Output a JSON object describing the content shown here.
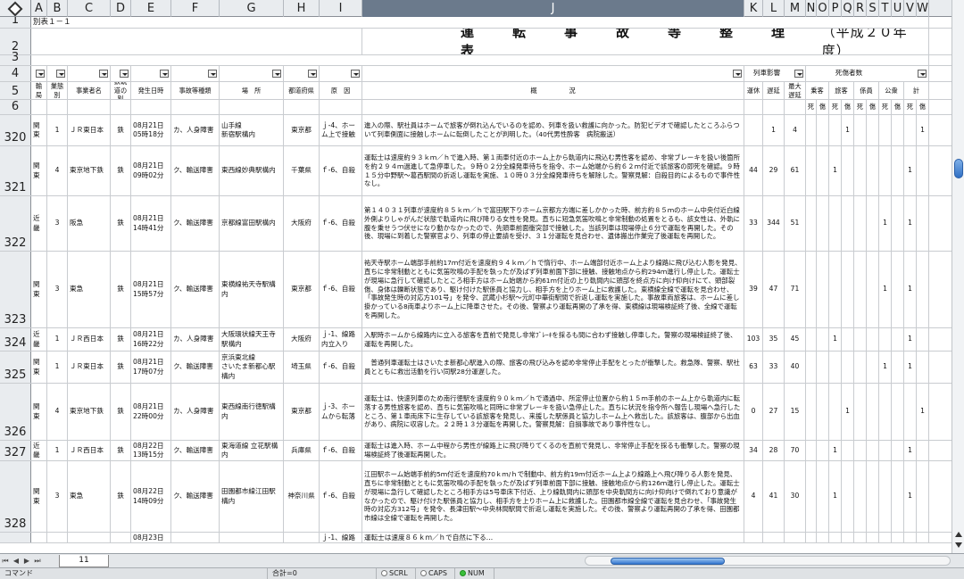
{
  "columns": [
    "A",
    "B",
    "C",
    "D",
    "E",
    "F",
    "G",
    "H",
    "I",
    "J",
    "K",
    "L",
    "M",
    "N",
    "O",
    "P",
    "Q",
    "R",
    "S",
    "T",
    "U",
    "V",
    "W"
  ],
  "selected_column": "J",
  "rownum_labels": {
    "r1": "1",
    "r2": "2",
    "r3": "3",
    "r4": "4",
    "r5": "5",
    "r6": "6"
  },
  "sheet": {
    "subtitle": "別表１－１",
    "title": "運　転　事　故　等　整　理　表",
    "title_year": "（平成２０年度）",
    "headers": {
      "bureau": "運輸局名",
      "type": "業態別",
      "operator": "事業者名",
      "track": "鉄軌道の別",
      "datetime": "発生日時",
      "accident_type": "事故等種類",
      "place": "場　所",
      "prefecture": "都道府県",
      "cause": "原　因",
      "summary": "概　　　　　況",
      "train_impact": "列車影響",
      "cancel": "運休",
      "delay": "遅延",
      "max_delay": "最大遅延",
      "casualties": "死傷者数",
      "crew": "乗客",
      "passenger": "旅客",
      "staff": "係員",
      "public": "公衆",
      "total": "計",
      "dead": "死",
      "injured": "傷"
    }
  },
  "records": [
    {
      "row": "320",
      "bureau": "関東",
      "type": "1",
      "operator": "ＪＲ東日本",
      "track": "鉄",
      "date": "08月21日",
      "time": "05時18分",
      "accident": "カ、人身障害",
      "place": "山手線\n新宿駅構内",
      "pref": "東京都",
      "cause": "ｊ-4、ホーム上で接触",
      "summary": "進入の際、駅社員はホームで旅客が倒れ込んでいるのを認め、列車を扱い救護に向かった。防犯ビデオで確認したところふらついて列車側面に接触しホームに転倒したことが判明した。（40代男性酔客　病院搬送）",
      "cancel": "",
      "delay": "1",
      "max": "4",
      "marks": {
        "passenger_inj": "1",
        "total_inj": "1"
      }
    },
    {
      "row": "321",
      "bureau": "関東",
      "type": "4",
      "operator": "東京地下鉄",
      "track": "鉄",
      "date": "08月21日",
      "time": "09時02分",
      "accident": "ク、輸送障害",
      "place": "東西線妙典駅構内",
      "pref": "千葉県",
      "cause": "ｆ-6、自殺",
      "summary": "運転士は速度約９３ｋｍ／ｈで進入時、第１両車付近のホーム上から軌道内に飛込む男性客を認め、非常ブレーキを扱い後箇所を約２９４ｍ過進して急停車した。９時０２分全線発車待ちを指令、ホーム始端から約６２ｍ付近で該旅客の即死を確認。９時１５分中野駅～葛西駅間の折返し運転を実施、１０時０３分全線発車待ちを解除した。警察見解：自殺目的によるもので事件性なし。",
      "cancel": "44",
      "delay": "29",
      "max": "61",
      "marks": {
        "passenger_dead": "1",
        "total_dead": "1"
      }
    },
    {
      "row": "322",
      "bureau": "近畿",
      "type": "3",
      "operator": "阪急",
      "track": "鉄",
      "date": "08月21日",
      "time": "14時41分",
      "accident": "ク、輸送障害",
      "place": "京都線富田駅構内",
      "pref": "大阪府",
      "cause": "ｆ-6、自殺",
      "summary": "第１４０３１列車が速度約８５ｋｍ／ｈで富田駅下りホーム京都方方端に差しかかった時、前方約８５ｍのホーム中央付近白線外側よりしゃがんだ状態で軌道内に飛び降りる女性を発見。直ちに短急気笛吹鳴と非常制動の処置をとるも、該女性は、外軌に腹を乗せうつ伏せになり動かなかったので、先頭車前面衝突部で接触した。当該列車は現場停止６分で運転を再開した。その後、現場に到着した警察官より、列車の停止要請を受け、３１分運転を見合わせ、遺体搬出作業完了後運転を再開した。",
      "cancel": "33",
      "delay": "344",
      "max": "51",
      "marks": {
        "public_dead": "1",
        "total_dead": "1"
      }
    },
    {
      "row": "323",
      "bureau": "関東",
      "type": "3",
      "operator": "東急",
      "track": "鉄",
      "date": "08月21日",
      "time": "15時57分",
      "accident": "ク、輸送障害",
      "place": "東横線祐天寺駅構内",
      "pref": "東京都",
      "cause": "ｆ-6、自殺",
      "summary": "祐天寺駅ホーム端部手前約17ｍ付近を速度約９４ｋｍ／ｈで惰行中、ホーム端部付近ホーム上より線路に飛び込む人影を発見、直ちに非常制動とともに気笛吹鳴の手配を執ったが及ばず列車前面下部に接触、接触地点から約294ｍ進行し停止した。運転士が現場に急行して確認したところ相手方はホーム始端から約61ｍ付近の上り軌間内に頭部を終点方に向け仰向けにて、頭部裂傷、身体は轢断状態であり、駆け付けた駅係員と協力し、相手方を上りホーム上に救護した。東横線全線で運転を見合わせ、「事故発生時の対応方101号」を発令、武蔵小杉駅～元町中華街駅間で折返し運転を実施した。事故車両旅客は、ホームに差し掛かっている8両車よりホーム上に降車させた。その後、警察より運転再開の了承を得、東横線は現場検証終了後、全線で運転を再開した。",
      "cancel": "39",
      "delay": "47",
      "max": "71",
      "marks": {
        "public_dead": "1",
        "total_dead": "1"
      }
    },
    {
      "row": "324",
      "bureau": "近畿",
      "type": "1",
      "operator": "ＪＲ西日本",
      "track": "鉄",
      "date": "08月21日",
      "time": "16時22分",
      "accident": "カ、人身障害",
      "place": "大阪環状線天王寺駅構内",
      "pref": "大阪府",
      "cause": "ｊ-1、線路内立入り",
      "summary": "入駅時ホームから線路内に立入る旅客を直前で発見し非常ﾌﾞﾚｰｷを採るも間に合わず接触し停車した。警察の現場検証終了後、運転を再開した。",
      "cancel": "103",
      "delay": "35",
      "max": "45",
      "marks": {
        "passenger_dead": "1",
        "total_dead": "1"
      }
    },
    {
      "row": "325",
      "bureau": "関東",
      "type": "1",
      "operator": "ＪＲ東日本",
      "track": "鉄",
      "date": "08月21日",
      "time": "17時07分",
      "accident": "ク、輸送障害",
      "place": "京浜東北線\nさいたま新都心駅構内",
      "pref": "埼玉県",
      "cause": "ｆ-6、自殺",
      "summary": "　普通列車運転士はさいたま新都心駅進入の際、旅客の飛び込みを認め非常停止手配をとったが衝撃した。救急隊、警察、駅社員とともに救出活動を行い同駅28分運遅した。",
      "cancel": "63",
      "delay": "33",
      "max": "40",
      "marks": {
        "public_dead": "1",
        "total_dead": "1"
      }
    },
    {
      "row": "326",
      "bureau": "関東",
      "type": "4",
      "operator": "東京地下鉄",
      "track": "鉄",
      "date": "08月21日",
      "time": "22時00分",
      "accident": "カ、人身障害",
      "place": "東西線南行徳駅構内",
      "pref": "東京都",
      "cause": "ｊ-3、ホームから転落",
      "summary": "運転士は、快速列車のため南行徳駅を速度約９０ｋｍ／ｈで通過中、所定停止位置から約１５ｍ手前のホーム上から軌道内に転落する男性旅客を認め、直ちに気笛吹鳴と同時に非常ブレーキを扱い急停止した。直ちに状況を指令所へ報告し現場へ急行したところ、第１車両床下に生存している該旅客を発見し、来援した駅係員と協力しホーム上へ救出した。該旅客は、腹部から出血があり、病院に収容した。２２時１３分運転を再開した。警察見解：自損事故であり事件性なし。",
      "cancel": "0",
      "delay": "27",
      "max": "15",
      "marks": {
        "passenger_inj": "1",
        "total_inj": "1"
      }
    },
    {
      "row": "327",
      "bureau": "近畿",
      "type": "1",
      "operator": "ＪＲ西日本",
      "track": "鉄",
      "date": "08月22日",
      "time": "13時15分",
      "accident": "ク、輸送障害",
      "place": "東海道線 立花駅構内",
      "pref": "兵庫県",
      "cause": "ｆ-6、自殺",
      "summary": "運転士は進入時、ホーム中程から男性が線路上に飛び降りてくるのを直前で発見し、非常停止手配を採るも衝撃した。警察の現場検証終了後運転再開した。",
      "cancel": "34",
      "delay": "28",
      "max": "70",
      "marks": {
        "passenger_dead": "1",
        "total_dead": "1"
      }
    },
    {
      "row": "328",
      "bureau": "関東",
      "type": "3",
      "operator": "東急",
      "track": "鉄",
      "date": "08月22日",
      "time": "14時09分",
      "accident": "ク、輸送障害",
      "place": "田園都市線江田駅構内",
      "pref": "神奈川県",
      "cause": "ｆ-6、自殺",
      "summary": "江田駅ホーム始端手前約5ｍ付近を速度約70ｋｍ/ｈで制動中、前方約19ｍ付近ホーム上より線路上へ飛び降りる人影を発見、直ちに非常制動とともに気笛吹鳴の手配を執ったが及ばず列車前面下部に接触、接触地点から約126ｍ進行し停止した。運転士が現場に急行して確認したところ相手方は5号車床下付近、上り線軌間内に頭部を中央軌間方に向け仰向けで倒れており意識がなかったので、駆け付けた駅係員と協力し、相手方を上りホーム上に救護した。田園都市線全線で運転を見合わせ、「事故発生時の対応方312号」を発令、長津田駅～中央林間駅間で折返し運転を実施した。その後、警察より運転再開の了承を得、田園都市線は全線で運転を再開した。",
      "cancel": "4",
      "delay": "41",
      "max": "30",
      "marks": {
        "passenger_dead": "1",
        "total_dead": "1"
      }
    }
  ],
  "partial_row": {
    "date": "08月23日",
    "cause": "ｊ-1、線路",
    "summary": "運転士は速度８６ｋｍ／ｈで自然に下る…"
  },
  "bottom": {
    "sheet_tab": "11"
  },
  "status": {
    "mode": "コマンド",
    "sum": "合計=0",
    "scrl": "SCRL",
    "caps": "CAPS",
    "num": "NUM"
  }
}
